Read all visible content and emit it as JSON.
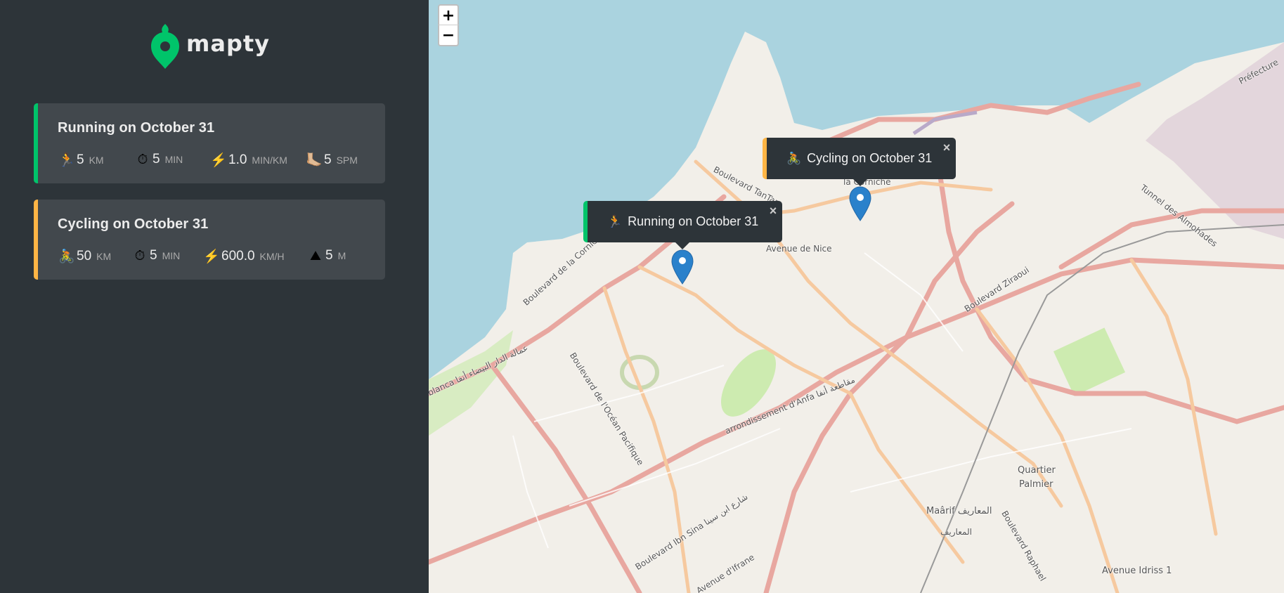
{
  "app": {
    "name": "mapty"
  },
  "workouts": [
    {
      "type": "running",
      "title": "Running on October 31",
      "stats": [
        {
          "icon": "🏃",
          "value": "5",
          "unit": "KM"
        },
        {
          "icon": "⏱",
          "value": "5",
          "unit": "MIN"
        },
        {
          "icon": "⚡️",
          "value": "1.0",
          "unit": "MIN/KM"
        },
        {
          "icon": "🦶🏼",
          "value": "5",
          "unit": "SPM"
        }
      ]
    },
    {
      "type": "cycling",
      "title": "Cycling on October 31",
      "stats": [
        {
          "icon": "🚴",
          "value": "50",
          "unit": "KM"
        },
        {
          "icon": "⏱",
          "value": "5",
          "unit": "MIN"
        },
        {
          "icon": "⚡️",
          "value": "600.0",
          "unit": "KM/H"
        },
        {
          "icon": "⛰",
          "value": "5",
          "unit": "M"
        }
      ]
    }
  ],
  "map": {
    "zoom_in": "+",
    "zoom_out": "−",
    "popups": [
      {
        "icon": "🚴",
        "text": "Cycling on October 31",
        "close": "×"
      },
      {
        "icon": "🏃",
        "text": "Running on October 31",
        "close": "×"
      }
    ],
    "labels": {
      "corniche": "Boulevard de la Corniche",
      "corniche2": "la Corniche",
      "tantan": "Boulevard TanTan",
      "nice": "Avenue de Nice",
      "ziraoui": "Boulevard Ziraoui",
      "almohades": "Tunnel des Almohades",
      "prefecture": "Préfecture",
      "ocean": "Boulevard de l'Océan Pacifique",
      "anfa": "arrondissement d'Anfa مقاطعة أنفا",
      "ibnsina": "Boulevard Ibn Sina شارع ابن سينا",
      "ifrane": "Avenue d'Ifrane",
      "quartier": "Quartier",
      "palmier": "Palmier",
      "maarif": "Maârif المعاريف",
      "maarif_ar": "المعاريف",
      "raphael": "Boulevard Raphael",
      "idriss": "Avenue Idriss 1",
      "casablanca": "blanca عمالة الدار البيضاء أنفا"
    }
  },
  "colors": {
    "running": "#00c46a",
    "cycling": "#ffb545",
    "sidebar": "#2d3439",
    "card": "#42484d",
    "sea": "#aad3df",
    "marker": "#2a81cb"
  }
}
